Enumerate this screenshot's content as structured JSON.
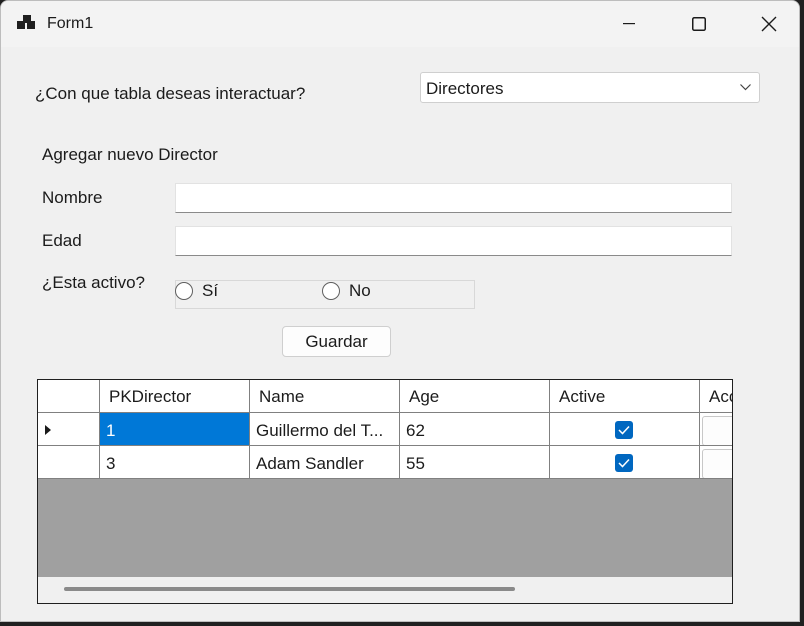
{
  "window": {
    "title": "Form1"
  },
  "form": {
    "table_prompt": "¿Con que tabla deseas interactuar?",
    "table_selected": "Directores",
    "section_title": "Agregar nuevo Director",
    "name_label": "Nombre",
    "name_value": "",
    "age_label": "Edad",
    "age_value": "",
    "active_label": "¿Esta activo?",
    "radio_yes": "Sí",
    "radio_no": "No",
    "save_label": "Guardar"
  },
  "grid": {
    "columns": [
      "PKDirector",
      "Name",
      "Age",
      "Active",
      "Acc"
    ],
    "rows": [
      {
        "pk": "1",
        "name": "Guillermo del T...",
        "age": "62",
        "active": true
      },
      {
        "pk": "3",
        "name": "Adam Sandler",
        "age": "55",
        "active": true
      }
    ]
  },
  "colors": {
    "accent": "#0067c0",
    "selection": "#0078d7",
    "grid_empty": "#a0a0a0"
  }
}
